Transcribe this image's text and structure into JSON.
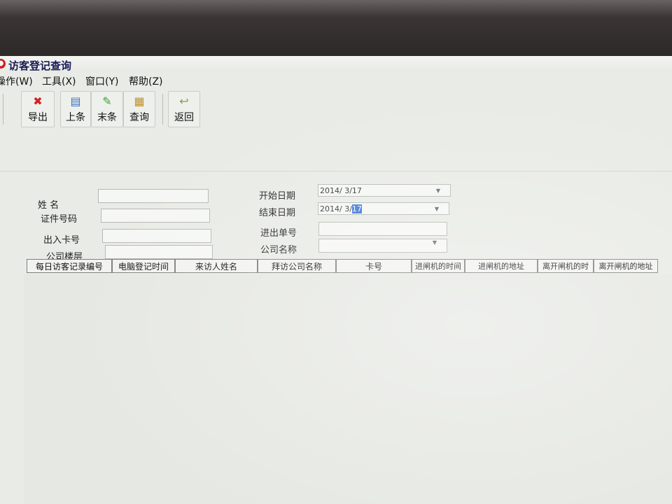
{
  "window": {
    "title": "访客登记查询"
  },
  "menu": [
    "操作(W)",
    "工具(X)",
    "窗口(Y)",
    "帮助(Z)"
  ],
  "toolbar": {
    "export": {
      "label": "导出",
      "icon": "export-icon"
    },
    "prev": {
      "label": "上条",
      "icon": "prev-record-icon"
    },
    "last": {
      "label": "末条",
      "icon": "last-record-icon"
    },
    "query": {
      "label": "查询",
      "icon": "query-icon"
    },
    "back": {
      "label": "返回",
      "icon": "return-icon"
    }
  },
  "form": {
    "name_label": "姓    名",
    "id_label": "证件号码",
    "card_label": "出入卡号",
    "floor_label": "公司楼层",
    "start_label": "开始日期",
    "end_label": "结束日期",
    "order_label": "进出单号",
    "company_label": "公司名称",
    "start_date": "2014/ 3/17",
    "end_date_prefix": "2014/ 3/",
    "end_date_day": "17"
  },
  "table": {
    "columns": [
      "每日访客记录编号",
      "电脑登记时间",
      "来访人姓名",
      "拜访公司名称",
      "卡号",
      "进闸机的时间",
      "进闸机的地址",
      "离开闸机的时",
      "离开闸机的地址"
    ]
  },
  "colors": {
    "accent": "#c8231f",
    "selection": "#3c78d8"
  }
}
